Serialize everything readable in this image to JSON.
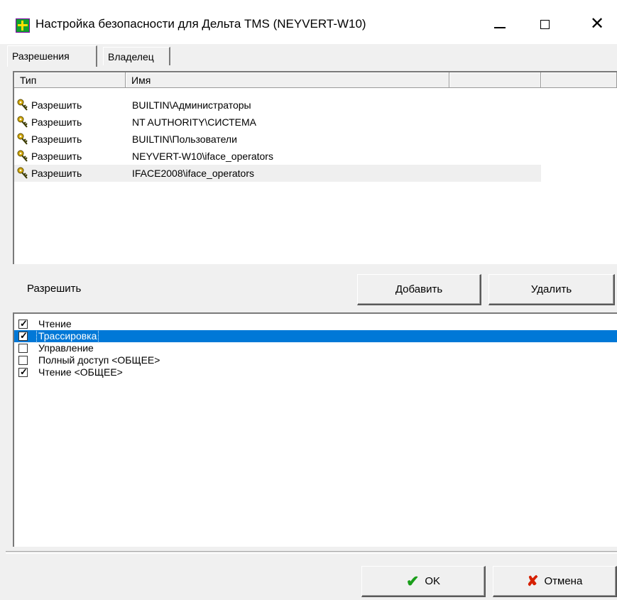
{
  "window": {
    "title": "Настройка безопасности для Дельта TMS (NEYVERT-W10)",
    "minimize_glyph": "—",
    "close_glyph": "✕"
  },
  "tabs": [
    {
      "label": "Разрешения",
      "active": true
    },
    {
      "label": "Владелец",
      "active": false
    }
  ],
  "permissions_list": {
    "columns": [
      "Тип",
      "Имя",
      "",
      ""
    ],
    "rows": [
      {
        "type": "Разрешить",
        "name": "BUILTIN\\Администраторы",
        "selected": false
      },
      {
        "type": "Разрешить",
        "name": "NT AUTHORITY\\СИСТЕМА",
        "selected": false
      },
      {
        "type": "Разрешить",
        "name": "BUILTIN\\Пользователи",
        "selected": false
      },
      {
        "type": "Разрешить",
        "name": "NEYVERT-W10\\iface_operators",
        "selected": false
      },
      {
        "type": "Разрешить",
        "name": "IFACE2008\\iface_operators",
        "selected": true
      }
    ]
  },
  "allow_label": "Разрешить",
  "buttons": {
    "add": "Добавить",
    "remove": "Удалить",
    "ok": "OK",
    "cancel": "Отмена"
  },
  "rights": [
    {
      "label": "Чтение",
      "checked": true,
      "selected": false
    },
    {
      "label": "Трассировка",
      "checked": true,
      "selected": true
    },
    {
      "label": "Управление",
      "checked": false,
      "selected": false
    },
    {
      "label": "Полный доступ <ОБЩЕЕ>",
      "checked": false,
      "selected": false
    },
    {
      "label": "Чтение <ОБЩЕЕ>",
      "checked": true,
      "selected": false
    }
  ],
  "colors": {
    "selection": "#0078d7",
    "ok_check": "#1a9e1a",
    "cancel_x": "#d62000"
  },
  "icons": {
    "app": "app-grid-icon",
    "row": "key-icon",
    "ok": "checkmark-icon",
    "cancel": "x-mark-icon"
  }
}
